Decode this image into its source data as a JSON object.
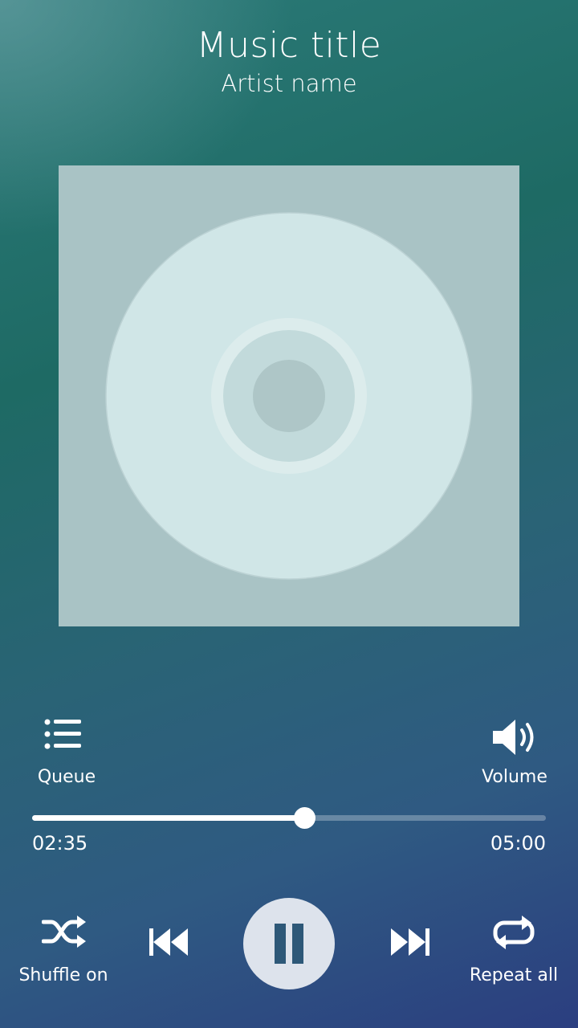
{
  "track": {
    "title": "Music title",
    "artist": "Artist name"
  },
  "controls": {
    "queue_label": "Queue",
    "volume_label": "Volume",
    "shuffle_label": "Shuffle on",
    "repeat_label": "Repeat all"
  },
  "progress": {
    "elapsed": "02:35",
    "total": "05:00",
    "fraction": 0.53
  },
  "icons": {
    "queue": "list-icon",
    "volume": "speaker-icon",
    "shuffle": "shuffle-icon",
    "previous": "skip-previous-icon",
    "play_pause": "pause-icon",
    "next": "skip-next-icon",
    "repeat": "repeat-icon"
  },
  "colors": {
    "background_top": "#2b7a78",
    "background_bottom": "#2b3e80",
    "album_art_bg": "#a9c3c5",
    "disc": "#d0e6e7",
    "pause_button": "#dde3ec",
    "pause_glyph": "#2d5878"
  },
  "state": {
    "playing": true,
    "shuffle": true,
    "repeat": "all"
  }
}
